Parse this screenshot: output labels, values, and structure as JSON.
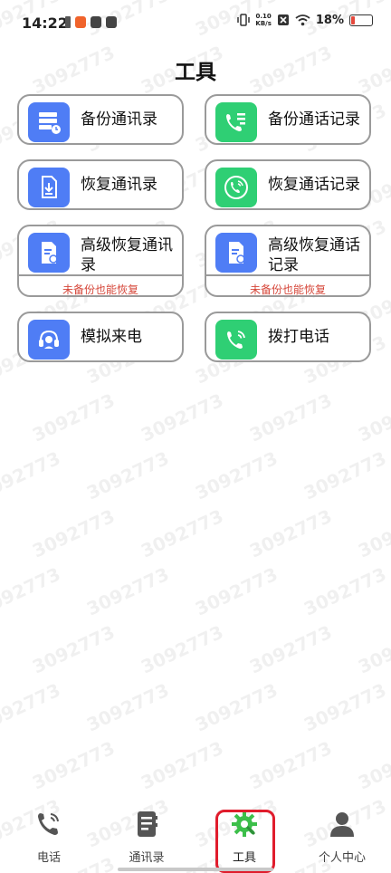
{
  "status_bar": {
    "time": "14:22",
    "net_speed_value": "0.10",
    "net_speed_unit": "KB/s",
    "battery_percent": "18%",
    "battery_level": 0.18
  },
  "page": {
    "title": "工具"
  },
  "tools": [
    {
      "label": "备份通讯录",
      "icon": "contacts-backup-icon",
      "color": "#4f7df5"
    },
    {
      "label": "备份通话记录",
      "icon": "call-log-backup-icon",
      "color": "#2fcf74"
    },
    {
      "label": "恢复通讯录",
      "icon": "contacts-restore-icon",
      "color": "#4f7df5"
    },
    {
      "label": "恢复通话记录",
      "icon": "call-log-restore-icon",
      "color": "#2fcf74"
    },
    {
      "label": "高级恢复通讯录",
      "icon": "advanced-restore-contacts-icon",
      "color": "#4f7df5",
      "sub": "未备份也能恢复"
    },
    {
      "label": "高级恢复通话记录",
      "icon": "advanced-restore-calls-icon",
      "color": "#4f7df5",
      "sub": "未备份也能恢复"
    },
    {
      "label": "模拟来电",
      "icon": "headset-icon",
      "color": "#4f7df5"
    },
    {
      "label": "拨打电话",
      "icon": "phone-call-icon",
      "color": "#2fcf74"
    }
  ],
  "tabbar": {
    "items": [
      {
        "label": "电话",
        "icon": "phone-icon"
      },
      {
        "label": "通讯录",
        "icon": "address-book-icon"
      },
      {
        "label": "工具",
        "icon": "gear-wrench-icon",
        "active": true
      },
      {
        "label": "个人中心",
        "icon": "person-icon"
      }
    ]
  },
  "watermark": {
    "text": "3092773"
  },
  "colors": {
    "accent_blue": "#4f7df5",
    "accent_green": "#2fcf74",
    "warning_red": "#d6473a",
    "highlight_red": "#e01c2c"
  }
}
